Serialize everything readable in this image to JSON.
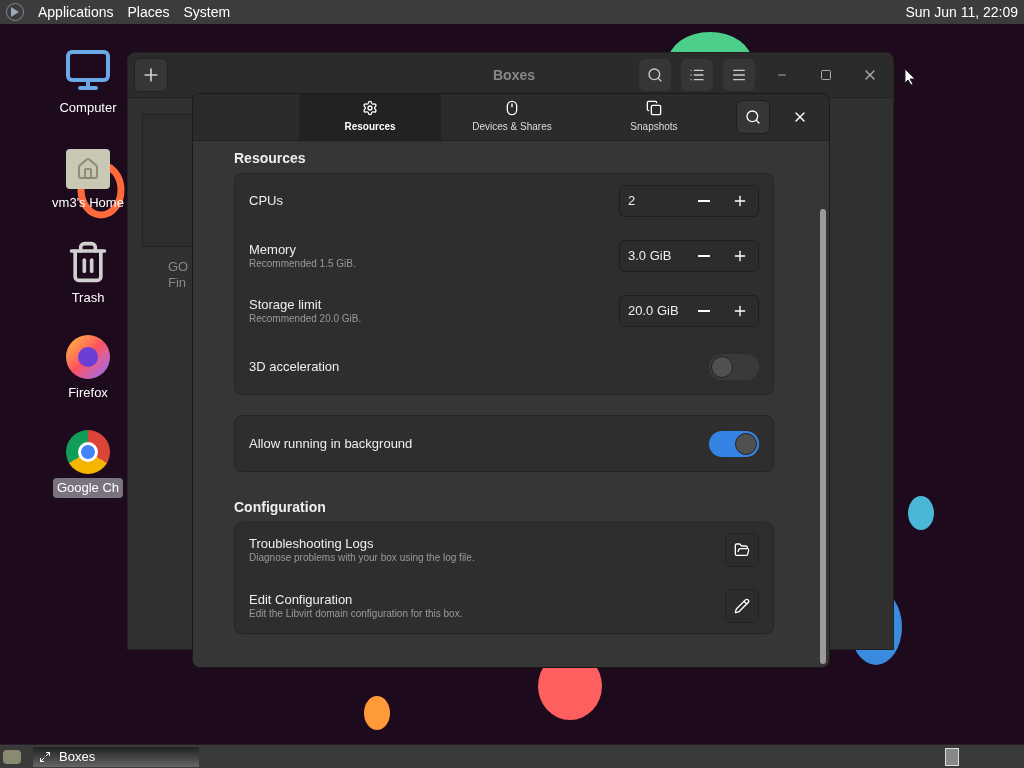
{
  "top_panel": {
    "menus": [
      "Applications",
      "Places",
      "System"
    ],
    "clock": "Sun Jun 11, 22:09"
  },
  "desktop_icons": [
    {
      "kind": "computer",
      "label": "Computer",
      "selected": false
    },
    {
      "kind": "home",
      "label": "vm3's Home",
      "selected": false
    },
    {
      "kind": "trash",
      "label": "Trash",
      "selected": false
    },
    {
      "kind": "firefox",
      "label": "Firefox",
      "selected": false
    },
    {
      "kind": "chrome",
      "label": "Google Ch",
      "selected": true
    }
  ],
  "background_window": {
    "title": "Boxes",
    "card_caption": [
      "GO",
      "Fin"
    ]
  },
  "dialog": {
    "tabs": [
      {
        "kind": "resources",
        "label": "Resources",
        "selected": true
      },
      {
        "kind": "devices",
        "label": "Devices & Shares",
        "selected": false
      },
      {
        "kind": "snapshots",
        "label": "Snapshots",
        "selected": false
      }
    ],
    "sections": [
      {
        "title": "Resources",
        "groups": [
          [
            {
              "kind": "spin",
              "label": "CPUs",
              "value": "2"
            },
            {
              "kind": "spin",
              "label": "Memory",
              "subtitle": "Recommended 1.5 GiB.",
              "value": "3.0 GiB"
            },
            {
              "kind": "spin",
              "label": "Storage limit",
              "subtitle": "Recommended 20.0 GiB.",
              "value": "20.0 GiB"
            },
            {
              "kind": "switch",
              "label": "3D acceleration",
              "on": false
            }
          ],
          [
            {
              "kind": "switch",
              "label": "Allow running in background",
              "on": true
            }
          ]
        ]
      },
      {
        "title": "Configuration",
        "groups": [
          [
            {
              "kind": "logs",
              "label": "Troubleshooting Logs",
              "subtitle": "Diagnose problems with your box using the log file."
            },
            {
              "kind": "edit",
              "label": "Edit Configuration",
              "subtitle": "Edit the Libvirt domain configuration for this box."
            }
          ]
        ]
      }
    ]
  },
  "taskbar": {
    "items": [
      {
        "label": "Boxes",
        "selected": true
      }
    ]
  }
}
